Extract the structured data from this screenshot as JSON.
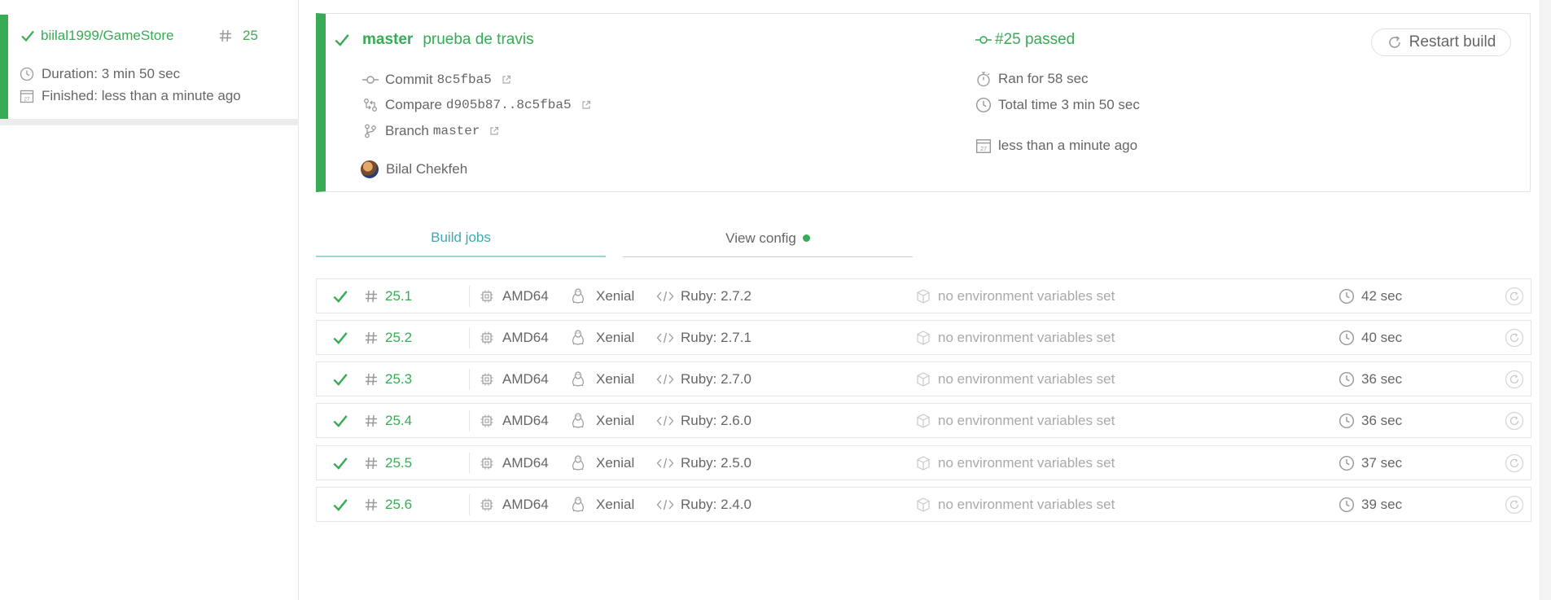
{
  "sidebar": {
    "repo": "biilal1999/GameStore",
    "build_number": "25",
    "duration": "Duration: 3 min 50 sec",
    "finished": "Finished: less than a minute ago"
  },
  "build": {
    "branch": "master",
    "message": "prueba de travis",
    "commit_label": "Commit",
    "commit_sha": "8c5fba5",
    "compare_label": "Compare",
    "compare_range": "d905b87..8c5fba5",
    "branch_label": "Branch",
    "branch_name": "master",
    "author": "Bilal Chekfeh",
    "status": "#25 passed",
    "ran_for": "Ran for 58 sec",
    "total_time": "Total time 3 min 50 sec",
    "finished_ago": "less than a minute ago",
    "restart_label": "Restart build",
    "calendar_day": "27"
  },
  "tabs": {
    "build_jobs": "Build jobs",
    "view_config": "View config"
  },
  "jobs": [
    {
      "number": "25.1",
      "arch": "AMD64",
      "os": "Xenial",
      "lang": "Ruby: 2.7.2",
      "env": "no environment variables set",
      "duration": "42 sec"
    },
    {
      "number": "25.2",
      "arch": "AMD64",
      "os": "Xenial",
      "lang": "Ruby: 2.7.1",
      "env": "no environment variables set",
      "duration": "40 sec"
    },
    {
      "number": "25.3",
      "arch": "AMD64",
      "os": "Xenial",
      "lang": "Ruby: 2.7.0",
      "env": "no environment variables set",
      "duration": "36 sec"
    },
    {
      "number": "25.4",
      "arch": "AMD64",
      "os": "Xenial",
      "lang": "Ruby: 2.6.0",
      "env": "no environment variables set",
      "duration": "36 sec"
    },
    {
      "number": "25.5",
      "arch": "AMD64",
      "os": "Xenial",
      "lang": "Ruby: 2.5.0",
      "env": "no environment variables set",
      "duration": "37 sec"
    },
    {
      "number": "25.6",
      "arch": "AMD64",
      "os": "Xenial",
      "lang": "Ruby: 2.4.0",
      "env": "no environment variables set",
      "duration": "39 sec"
    }
  ],
  "colors": {
    "passed": "#39aa56",
    "tab_active": "#3eaaaf",
    "text": "#666666",
    "muted": "#a9a9a9"
  }
}
